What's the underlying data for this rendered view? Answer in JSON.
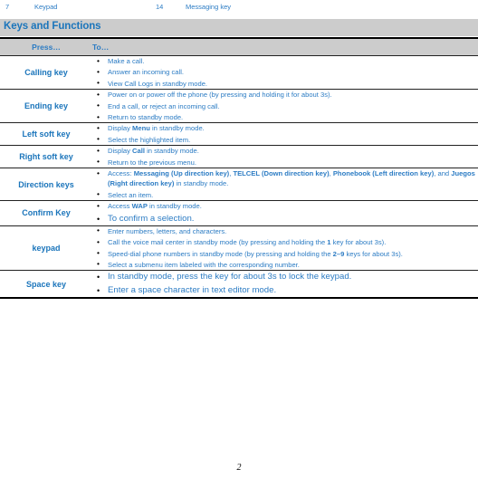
{
  "running_head": {
    "entry1_number": "7",
    "entry1_label": "Keypad",
    "entry2_number": "14",
    "entry2_label": "Messaging key"
  },
  "section": {
    "title": "Keys and Functions",
    "band_color": "#cccccc",
    "title_color": "#1b75bb"
  },
  "table": {
    "columns": {
      "press_header": "Press…",
      "to_header": "To…"
    },
    "rows": [
      {
        "key": "Calling key",
        "items": [
          {
            "parts": [
              {
                "t": "Make a call.",
                "bold": false
              }
            ]
          },
          {
            "parts": [
              {
                "t": "Answer an incoming call.",
                "bold": false
              }
            ]
          },
          {
            "parts": [
              {
                "t": "View Call Logs in standby mode.",
                "bold": false
              }
            ]
          }
        ]
      },
      {
        "key": "Ending key",
        "items": [
          {
            "parts": [
              {
                "t": "Power on or power off the phone (by pressing and holding it for about 3s).",
                "bold": false
              }
            ]
          },
          {
            "parts": [
              {
                "t": "End a call, or reject an incoming call.",
                "bold": false
              }
            ]
          },
          {
            "parts": [
              {
                "t": "Return to standby mode.",
                "bold": false
              }
            ]
          }
        ]
      },
      {
        "key": "Left soft key",
        "items": [
          {
            "parts": [
              {
                "t": "Display ",
                "bold": false
              },
              {
                "t": "Menu",
                "bold": true
              },
              {
                "t": " in standby mode.",
                "bold": false
              }
            ]
          },
          {
            "parts": [
              {
                "t": "Select the highlighted item.",
                "bold": false
              }
            ]
          }
        ]
      },
      {
        "key": "Right soft key",
        "items": [
          {
            "parts": [
              {
                "t": "Display ",
                "bold": false
              },
              {
                "t": "Call",
                "bold": true
              },
              {
                "t": " in standby mode.",
                "bold": false
              }
            ]
          },
          {
            "parts": [
              {
                "t": "Return to the previous menu.",
                "bold": false
              }
            ]
          }
        ]
      },
      {
        "key": "Direction keys",
        "items": [
          {
            "parts": [
              {
                "t": "Access: ",
                "bold": false
              },
              {
                "t": "Messaging (Up direction key)",
                "bold": true
              },
              {
                "t": ", ",
                "bold": false
              },
              {
                "t": "TELCEL (Down direction key)",
                "bold": true
              },
              {
                "t": ", ",
                "bold": false
              },
              {
                "t": "Phonebook (Left direction key)",
                "bold": true
              },
              {
                "t": ", and ",
                "bold": false
              },
              {
                "t": "Juegos (Right direction key)",
                "bold": true
              },
              {
                "t": " in standby mode.",
                "bold": false
              }
            ]
          },
          {
            "parts": [
              {
                "t": "Select an item.",
                "bold": false
              }
            ]
          }
        ]
      },
      {
        "key": "Confirm Key",
        "items": [
          {
            "parts": [
              {
                "t": "Access ",
                "bold": false
              },
              {
                "t": "WAP",
                "bold": true
              },
              {
                "t": " in standby mode.",
                "bold": false
              }
            ]
          },
          {
            "big": true,
            "parts": [
              {
                "t": "To confirm a selection.",
                "bold": false
              }
            ]
          }
        ]
      },
      {
        "key": "keypad",
        "items": [
          {
            "parts": [
              {
                "t": "Enter numbers, letters, and characters.",
                "bold": false
              }
            ]
          },
          {
            "parts": [
              {
                "t": "Call the voice mail center in standby mode (by pressing and holding the ",
                "bold": false
              },
              {
                "t": "1",
                "bold": true
              },
              {
                "t": " key for about 3s).",
                "bold": false
              }
            ]
          },
          {
            "parts": [
              {
                "t": "Speed-dial phone numbers in standby mode (by pressing and holding the ",
                "bold": false
              },
              {
                "t": "2–9",
                "bold": true
              },
              {
                "t": " keys for about 3s).",
                "bold": false
              }
            ]
          },
          {
            "parts": [
              {
                "t": "Select a submenu item labeled with the corresponding number.",
                "bold": false
              }
            ]
          }
        ]
      },
      {
        "key": "Space key",
        "items": [
          {
            "big": true,
            "parts": [
              {
                "t": "In standby mode, press the key for about 3s to lock the keypad.",
                "bold": false
              }
            ]
          },
          {
            "big": true,
            "parts": [
              {
                "t": "Enter a space character in text editor mode.",
                "bold": false
              }
            ]
          }
        ]
      }
    ]
  },
  "footer": {
    "page_number": "2"
  }
}
